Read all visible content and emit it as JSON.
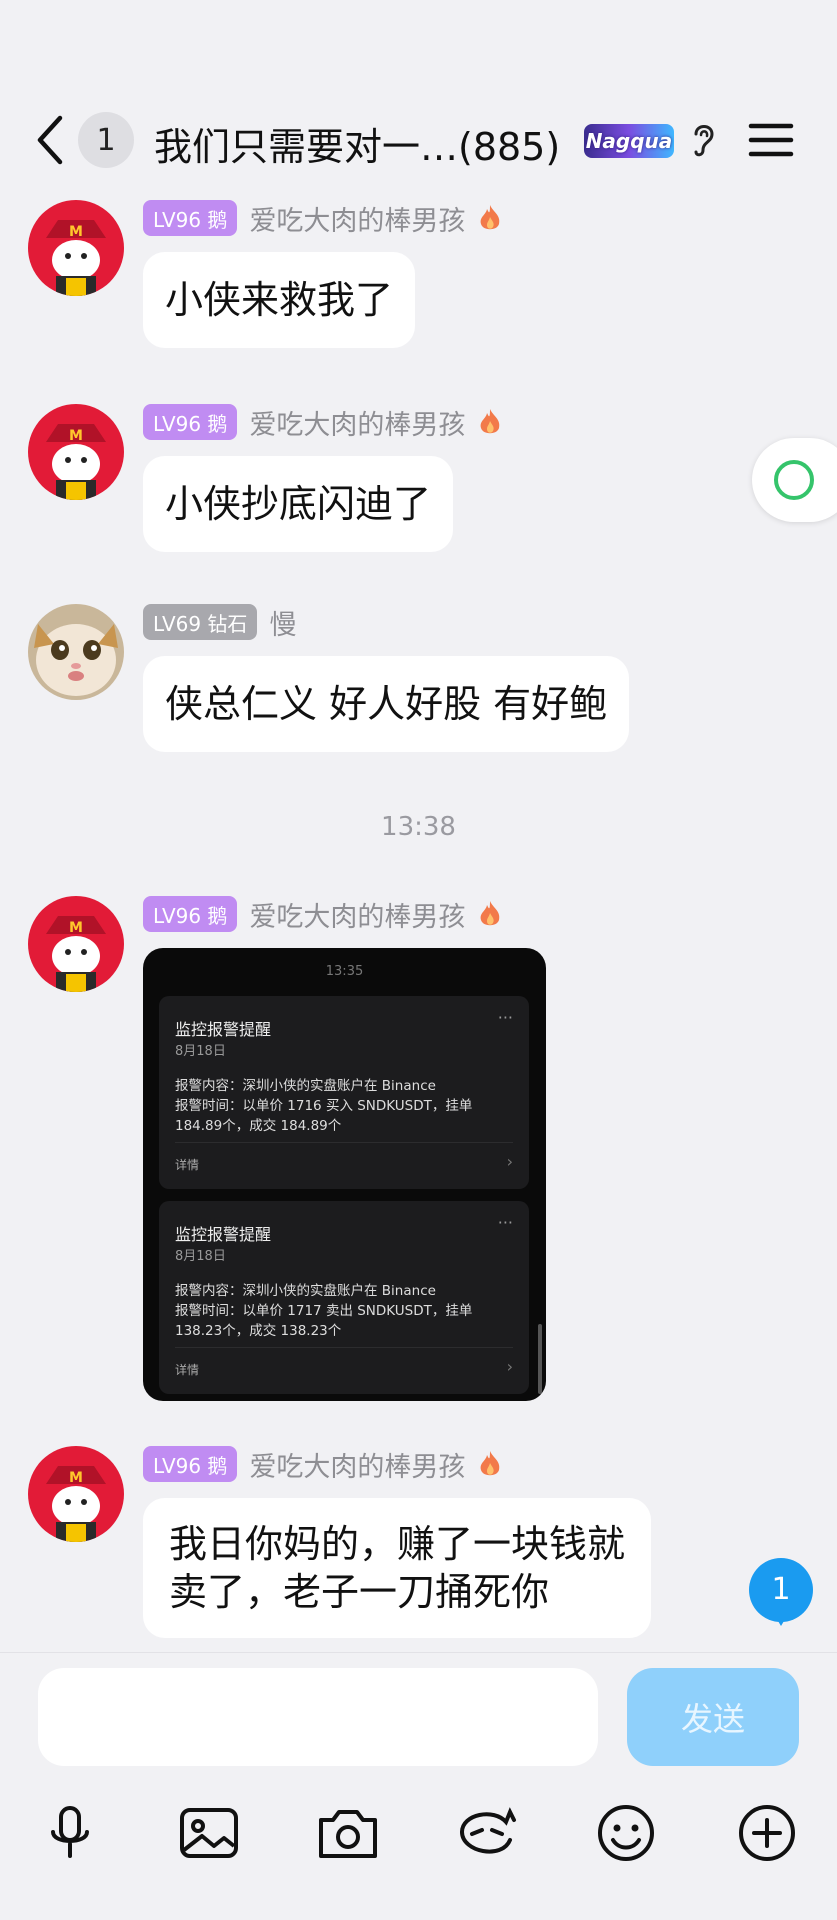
{
  "header": {
    "unread_count": "1",
    "title": "我们只需要对一…(885)",
    "group_badge": "Nagqua"
  },
  "messages": [
    {
      "level": "LV96 鹅",
      "sender": "爱吃大肉的棒男孩",
      "text": "小侠来救我了"
    },
    {
      "level": "LV96 鹅",
      "sender": "爱吃大肉的棒男孩",
      "text": "小侠抄底闪迪了"
    },
    {
      "level": "LV69 钻石",
      "sender": "慢",
      "text": "侠总仁义 好人好股 有好鲍"
    }
  ],
  "time_separator": "13:38",
  "image_message": {
    "level": "LV96 鹅",
    "sender": "爱吃大肉的棒男孩",
    "screenshot": {
      "time": "13:35",
      "alerts": [
        {
          "title": "监控报警提醒",
          "date": "8月18日",
          "line1": "报警内容：深圳小侠的实盘账户在 Binance",
          "line2": "报警时间：以单价 1716 买入 SNDKUSDT，挂单",
          "line3": "184.89个，成交 184.89个",
          "link": "详情"
        },
        {
          "title": "监控报警提醒",
          "date": "8月18日",
          "line1": "报警内容：深圳小侠的实盘账户在 Binance",
          "line2": "报警时间：以单价 1717 卖出 SNDKUSDT，挂单",
          "line3": "138.23个，成交 138.23个",
          "link": "详情"
        }
      ]
    }
  },
  "last_message": {
    "level": "LV96 鹅",
    "sender": "爱吃大肉的棒男孩",
    "line1": "我日你妈的，赚了一块钱就",
    "line2": "卖了，老子一刀捅死你"
  },
  "new_message_count": "1",
  "input": {
    "placeholder": "",
    "send_label": "发送"
  },
  "toolbar_icons": [
    "microphone-icon",
    "image-icon",
    "camera-icon",
    "sticker-icon",
    "emoji-icon",
    "plus-icon"
  ],
  "colors": {
    "level_purple": "#c08cf2",
    "level_gray": "#a8a8ad",
    "send_button": "#8fd0fb",
    "accent_blue": "#1a9bf0"
  }
}
